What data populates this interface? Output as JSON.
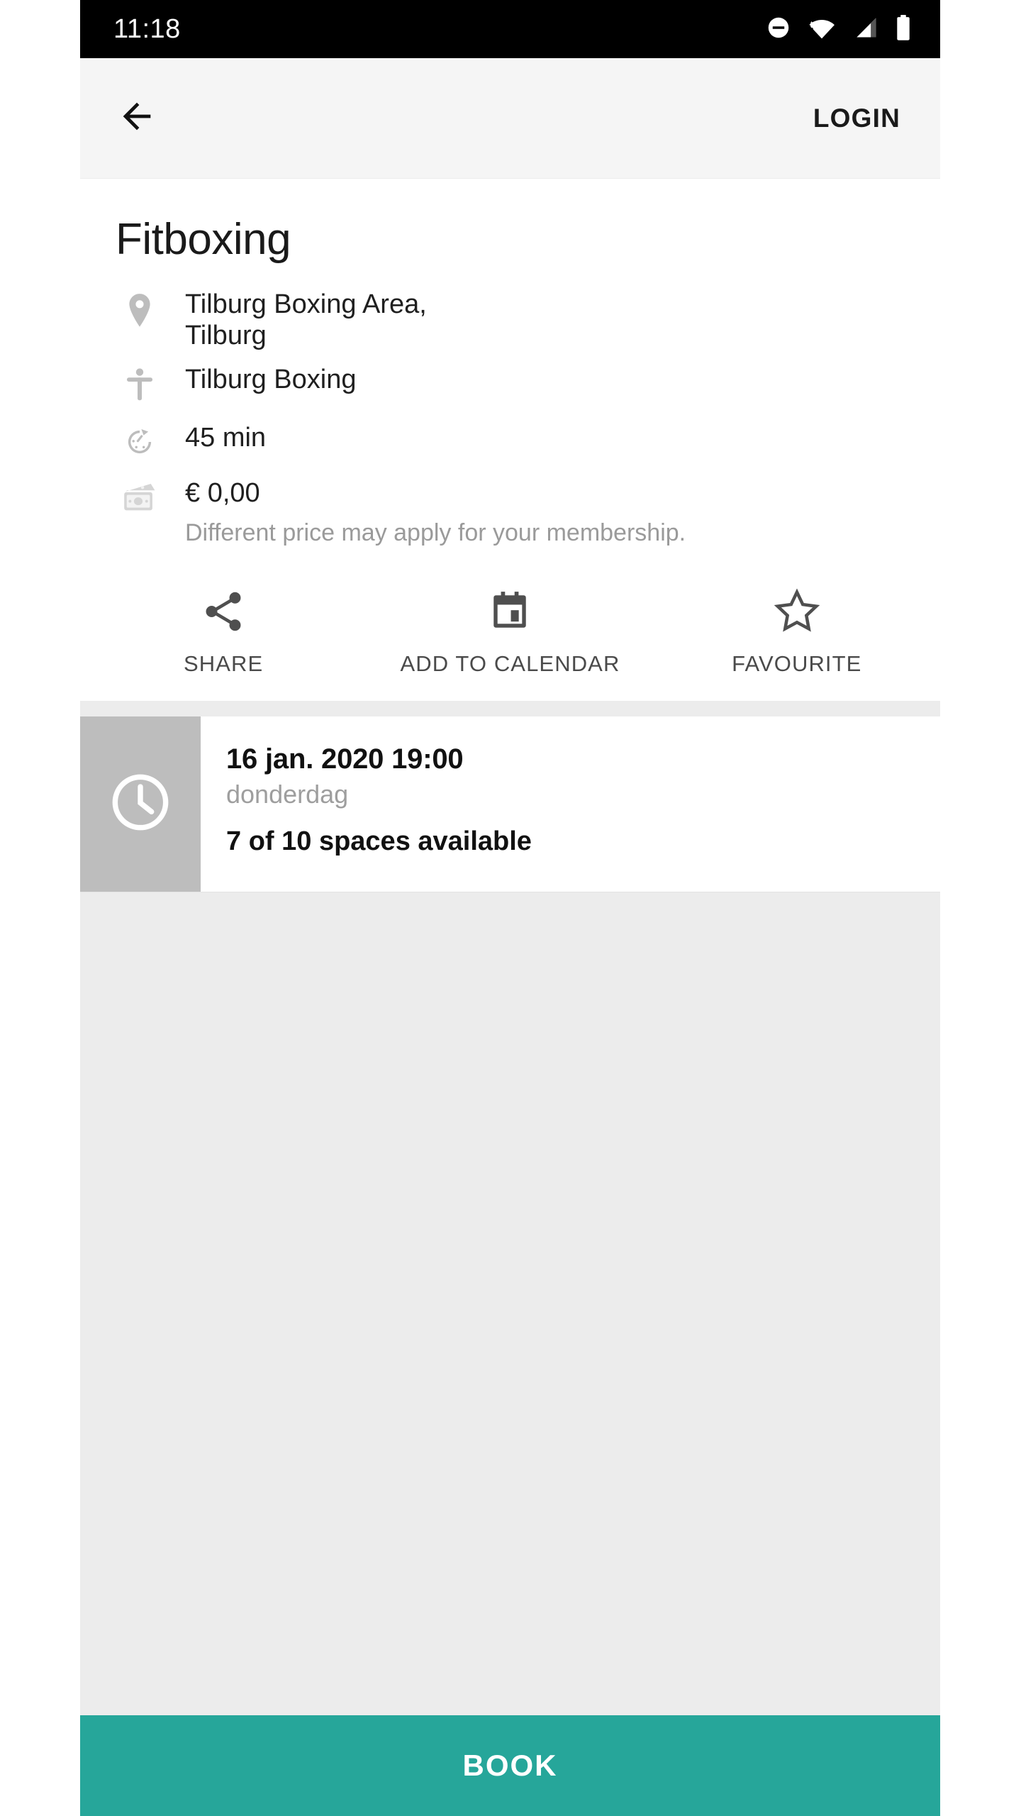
{
  "statusbar": {
    "time": "11:18",
    "icons": [
      "do-not-disturb-icon",
      "wifi-icon",
      "cellular-signal-icon",
      "battery-icon"
    ]
  },
  "appbar": {
    "back_icon": "back-arrow-icon",
    "login_label": "LOGIN"
  },
  "activity": {
    "title": "Fitboxing",
    "details": [
      {
        "icon": "location-pin-icon",
        "text": "Tilburg Boxing Area,\nTilburg"
      },
      {
        "icon": "person-icon",
        "text": "Tilburg Boxing"
      },
      {
        "icon": "timer-icon",
        "text": "45 min"
      },
      {
        "icon": "money-icon",
        "text": "€ 0,00"
      }
    ],
    "location_line1": "Tilburg Boxing Area,",
    "location_line2": "Tilburg",
    "instructor": "Tilburg Boxing",
    "duration": "45 min",
    "price": "€ 0,00",
    "price_note": "Different price may apply for your membership."
  },
  "actions": [
    {
      "icon": "share-icon",
      "label": "SHARE"
    },
    {
      "icon": "calendar-icon",
      "label": "ADD TO CALENDAR"
    },
    {
      "icon": "star-outline-icon",
      "label": "FAVOURITE"
    }
  ],
  "sessions": [
    {
      "thumb_icon": "clock-icon",
      "datetime": "16 jan. 2020 19:00",
      "weekday": "donderdag",
      "availability": "7 of 10 spaces available"
    }
  ],
  "footer": {
    "book_label": "BOOK"
  },
  "colors": {
    "accent": "#26a69a",
    "appbar_bg": "#f5f5f5",
    "page_bg": "#ececec",
    "thumb_bg": "#bdbdbd",
    "muted_text": "#9e9e9e"
  }
}
